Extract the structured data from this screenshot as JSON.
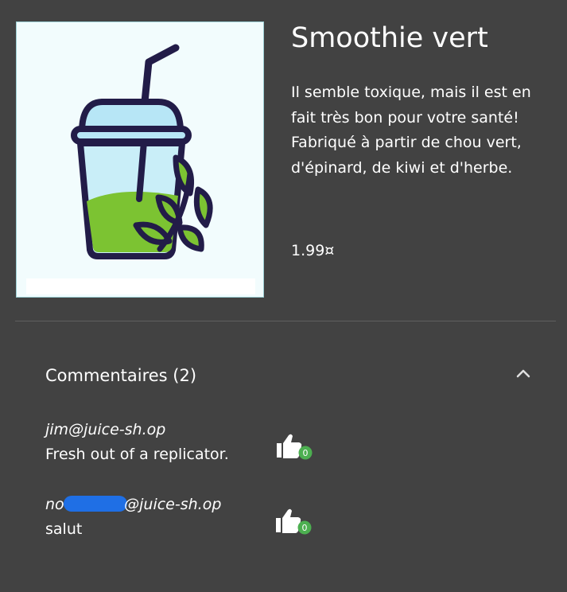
{
  "product": {
    "title": "Smoothie vert",
    "description": "Il semble toxique, mais il est en fait très bon pour votre santé! Fabriqué à partir de chou vert, d'épinard, de kiwi et d'herbe.",
    "price": "1.99¤",
    "image_icon": "green-smoothie-cup-illustration"
  },
  "comments": {
    "title": "Commentaires (2)",
    "expand_icon": "chevron-up-icon",
    "items": [
      {
        "author": "jim@juice-sh.op",
        "text": "Fresh out of a replicator.",
        "likes": "0"
      },
      {
        "author_prefix": "not",
        "author_suffix": "@juice-sh.op",
        "text": "salut",
        "likes": "0"
      }
    ]
  },
  "colors": {
    "background": "#424242",
    "accent_green": "#4caf50",
    "redaction_blue": "#1f6fe5"
  }
}
